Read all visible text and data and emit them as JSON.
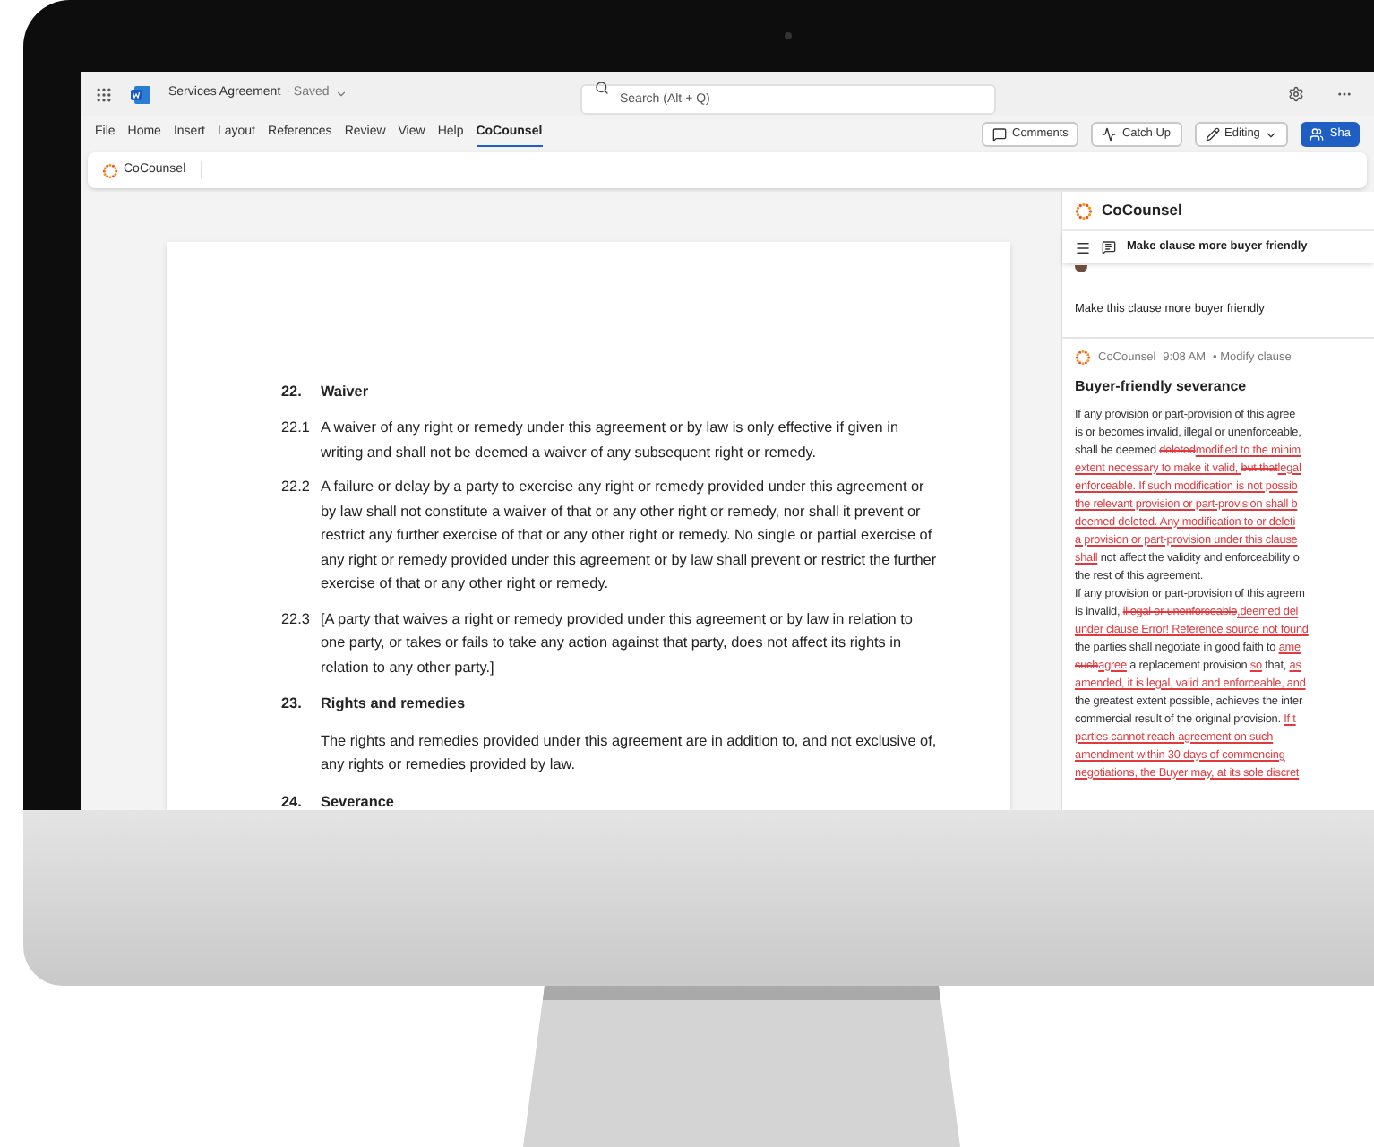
{
  "app": {
    "title": "Services Agreement",
    "status": "· Saved",
    "search_placeholder": "Search (Alt + Q)"
  },
  "menu_tabs": [
    {
      "label": "File",
      "selected": false
    },
    {
      "label": "Home",
      "selected": false
    },
    {
      "label": "Insert",
      "selected": false
    },
    {
      "label": "Layout",
      "selected": false
    },
    {
      "label": "References",
      "selected": false
    },
    {
      "label": "Review",
      "selected": false
    },
    {
      "label": "View",
      "selected": false
    },
    {
      "label": "Help",
      "selected": false
    },
    {
      "label": "CoCounsel",
      "selected": true
    }
  ],
  "toolbar_buttons": [
    {
      "label": "Comments",
      "kind": "comments"
    },
    {
      "label": "Catch Up",
      "kind": "catchup"
    },
    {
      "label": "Editing",
      "kind": "editing"
    },
    {
      "label": "Sha",
      "kind": "share"
    }
  ],
  "ribbon": {
    "label": "CoCounsel"
  },
  "document": {
    "sections": [
      {
        "number": "22.",
        "heading": "Waiver",
        "clauses": [
          {
            "number": "22.1",
            "text": "A waiver of any right or remedy under this agreement or by law is only effective if given in writing and shall not be deemed a waiver of any subsequent right or remedy."
          },
          {
            "number": "22.2",
            "text": "A failure or delay by a party to exercise any right or remedy provided under this agreement or by law shall not constitute a waiver of that or any other right or remedy, nor shall it prevent or restrict any further exercise of that or any other right or remedy. No single or partial exercise of any right or remedy provided under this agreement or by law shall prevent or restrict the further exercise of that or any other right or remedy."
          },
          {
            "number": "22.3",
            "text": "[A party that waives a right or remedy provided under this agreement or by law in relation to one party, or takes or fails to take any action against that party, does not affect its rights in relation to any other party.]"
          }
        ]
      },
      {
        "number": "23.",
        "heading": "Rights and remedies",
        "body": "The rights and remedies provided under this agreement are in addition to, and not exclusive of, any rights or remedies provided by law."
      },
      {
        "number": "24.",
        "heading": "Severance"
      }
    ]
  },
  "panel": {
    "title": "CoCounsel",
    "thread_title": "Make clause more buyer friendly",
    "user_message": "Make this clause more buyer friendly",
    "response": {
      "author": "CoCounsel",
      "time": "9:08 AM",
      "action": "• Modify clause",
      "heading": "Buyer-friendly severance",
      "lines": [
        [
          {
            "kind": "plain",
            "text": "If any provision or part-provision of this agree"
          }
        ],
        [
          {
            "kind": "plain",
            "text": "is or becomes invalid, illegal or unenforceable,"
          }
        ],
        [
          {
            "kind": "plain",
            "text": "shall be deemed "
          },
          {
            "kind": "deleted",
            "text": "deleted"
          },
          {
            "kind": "inserted",
            "text": "modified to the minim"
          }
        ],
        [
          {
            "kind": "inserted",
            "text": "extent necessary to make it valid, "
          },
          {
            "kind": "deleted",
            "text": "but that"
          },
          {
            "kind": "inserted",
            "text": "legal"
          }
        ],
        [
          {
            "kind": "inserted",
            "text": "enforceable. If such modification is not possib"
          }
        ],
        [
          {
            "kind": "inserted",
            "text": "the relevant provision or part-provision shall b"
          }
        ],
        [
          {
            "kind": "inserted",
            "text": "deemed deleted. Any modification to or deleti"
          }
        ],
        [
          {
            "kind": "inserted",
            "text": "a provision or part-provision under this clause"
          }
        ],
        [
          {
            "kind": "inserted",
            "text": "shall"
          },
          {
            "kind": "plain",
            "text": " not affect the validity and enforceability o"
          }
        ],
        [
          {
            "kind": "plain",
            "text": "the rest of this agreement."
          }
        ],
        [
          {
            "kind": "plain",
            "text": "If any provision or part-provision of this agreem"
          }
        ],
        [
          {
            "kind": "plain",
            "text": "is invalid, "
          },
          {
            "kind": "deleted",
            "text": "illegal or unenforceable"
          },
          {
            "kind": "inserted",
            "text": ",deemed del"
          }
        ],
        [
          {
            "kind": "inserted",
            "text": "under clause Error! Reference source not found"
          }
        ],
        [
          {
            "kind": "plain",
            "text": "the parties shall negotiate in good faith to "
          },
          {
            "kind": "inserted",
            "text": "ame"
          }
        ],
        [
          {
            "kind": "deleted",
            "text": "such"
          },
          {
            "kind": "inserted",
            "text": "agree"
          },
          {
            "kind": "plain",
            "text": " a replacement provision "
          },
          {
            "kind": "inserted",
            "text": "so"
          },
          {
            "kind": "plain",
            "text": " that, "
          },
          {
            "kind": "inserted",
            "text": "as"
          }
        ],
        [
          {
            "kind": "inserted",
            "text": "amended, it is legal, valid and enforceable, and"
          }
        ],
        [
          {
            "kind": "plain",
            "text": "the greatest extent possible, achieves the inter"
          }
        ],
        [
          {
            "kind": "plain",
            "text": "commercial result of the original provision. "
          },
          {
            "kind": "inserted",
            "text": "If t"
          }
        ],
        [
          {
            "kind": "inserted",
            "text": "parties cannot reach agreement on such"
          }
        ],
        [
          {
            "kind": "inserted",
            "text": "amendment within 30 days of commencing"
          }
        ],
        [
          {
            "kind": "inserted",
            "text": "negotiations, the Buyer may, at its sole discret"
          }
        ]
      ]
    }
  }
}
